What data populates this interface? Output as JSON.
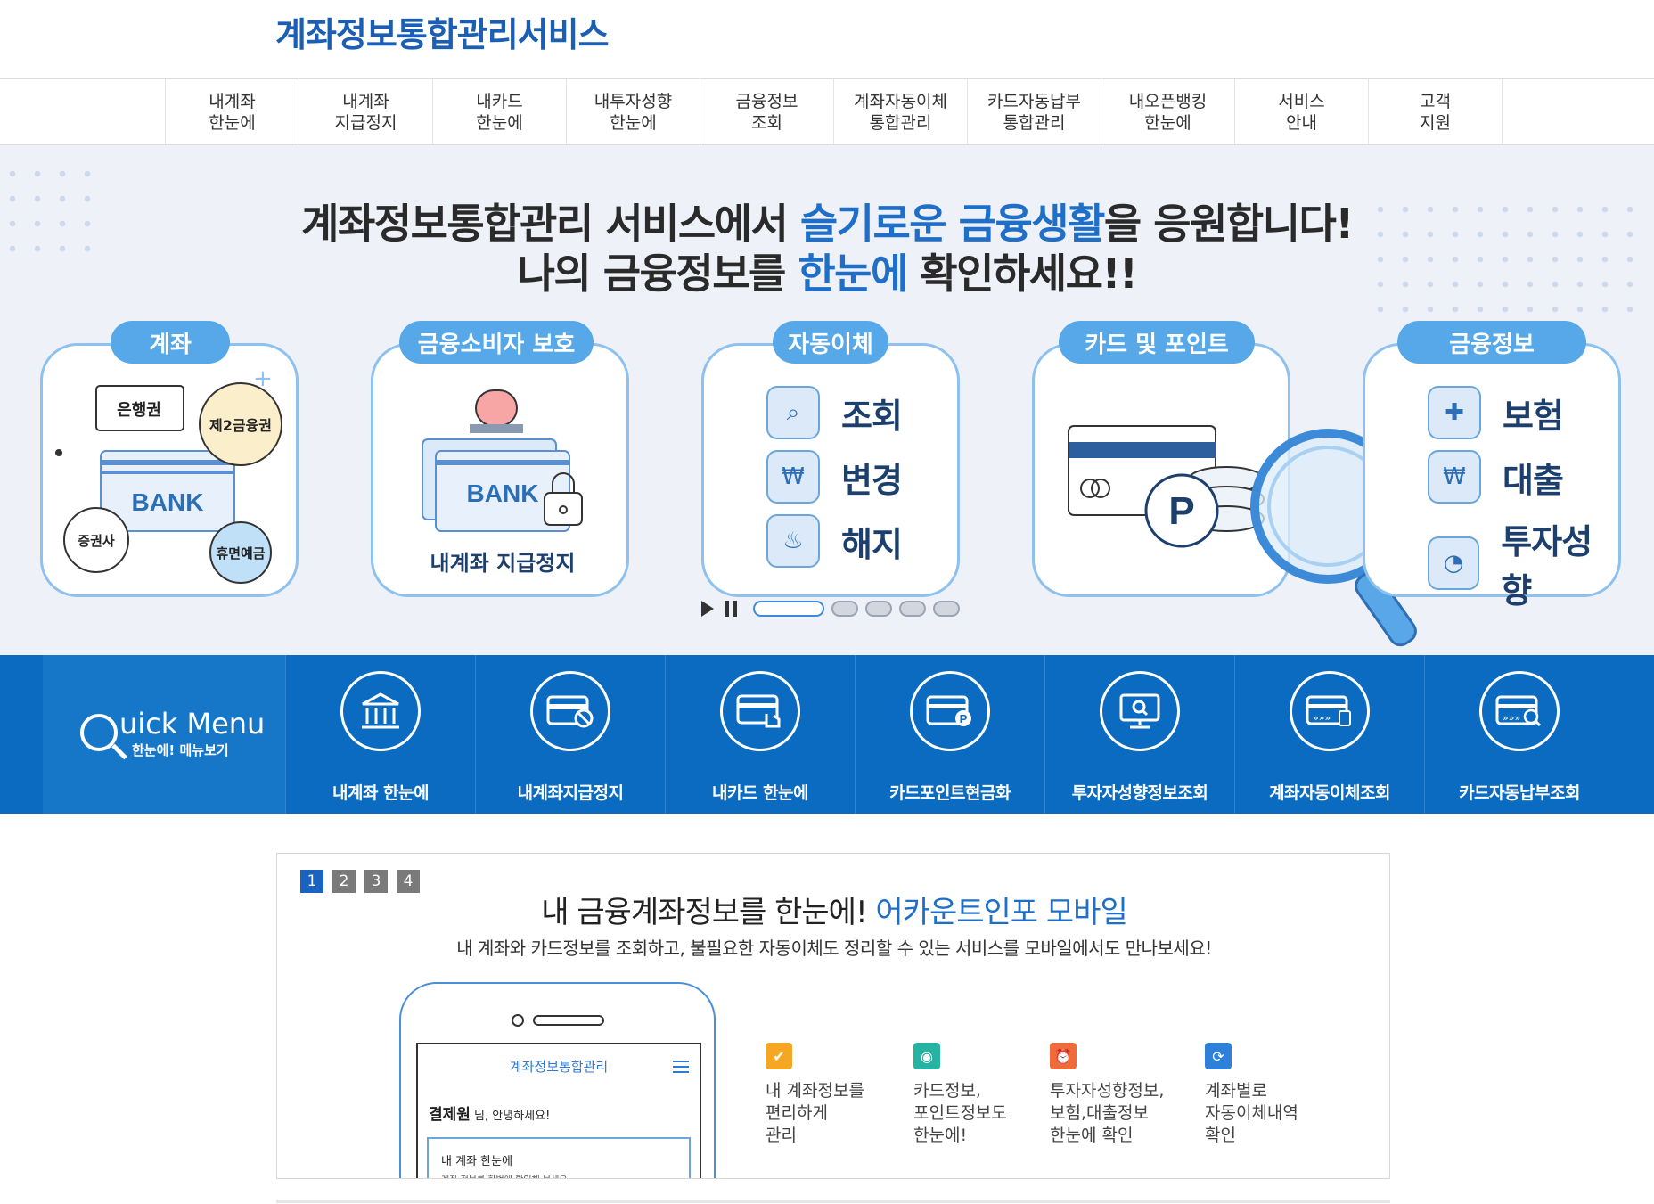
{
  "site": {
    "logo": "계좌정보통합관리서비스"
  },
  "gnb": [
    {
      "l1": "내계좌",
      "l2": "한눈에"
    },
    {
      "l1": "내계좌",
      "l2": "지급정지"
    },
    {
      "l1": "내카드",
      "l2": "한눈에"
    },
    {
      "l1": "내투자성향",
      "l2": "한눈에"
    },
    {
      "l1": "금융정보",
      "l2": "조회"
    },
    {
      "l1": "계좌자동이체",
      "l2": "통합관리"
    },
    {
      "l1": "카드자동납부",
      "l2": "통합관리"
    },
    {
      "l1": "내오픈뱅킹",
      "l2": "한눈에"
    },
    {
      "l1": "서비스",
      "l2": "안내"
    },
    {
      "l1": "고객",
      "l2": "지원"
    }
  ],
  "hero": {
    "line1_a": "계좌정보통합관리 서비스에서 ",
    "line1_hl": "슬기로운 금융생활",
    "line1_b": "을 응원합니다!",
    "line2_a": "나의 금융정보를 ",
    "line2_hl": "한눈에",
    "line2_b": " 확인하세요!!",
    "cards": [
      {
        "tag": "계좌",
        "bubbles": [
          "은행권",
          "제2금융권",
          "증권사",
          "휴면예금"
        ],
        "bank": "BANK"
      },
      {
        "tag": "금융소비자 보호",
        "bank": "BANK",
        "caption": "내계좌 지급정지"
      },
      {
        "tag": "자동이체",
        "items": [
          "조회",
          "변경",
          "해지"
        ]
      },
      {
        "tag": "카드 및 포인트",
        "point": "P"
      },
      {
        "tag": "금융정보",
        "items": [
          "보험",
          "대출",
          "투자성향"
        ]
      }
    ]
  },
  "quick": {
    "title": "uick Menu",
    "subtitle": "한눈에! 메뉴보기",
    "items": [
      "내계좌 한눈에",
      "내계좌지급정지",
      "내카드 한눈에",
      "카드포인트현금화",
      "투자자성향정보조회",
      "계좌자동이체조회",
      "카드자동납부조회"
    ]
  },
  "promo": {
    "tabs": [
      "1",
      "2",
      "3",
      "4"
    ],
    "title_a": "내 금융계좌정보를 한눈에! ",
    "title_hl": "어카운트인포 모바일",
    "subtitle": "내 계좌와 카드정보를 조회하고, 불필요한 자동이체도 정리할 수 있는 서비스를 모바일에서도 만나보세요!",
    "phone": {
      "app_title": "계좌정보통합관리",
      "user": "결제원",
      "greeting": " 님, 안녕하세요!",
      "box_title": "내 계좌 한눈에",
      "box_sub": "계좌 정보를 한번에 확인해 보세요!"
    },
    "features": [
      {
        "text": "내 계좌정보를\n편리하게\n관리",
        "color": "#f5a623"
      },
      {
        "text": "카드정보,\n포인트정보도\n한눈에!",
        "color": "#27b3a2"
      },
      {
        "text": "투자자성향정보,\n보험,대출정보\n한눈에 확인",
        "color": "#ef6b3a"
      },
      {
        "text": "계좌별로\n자동이체내역\n확인",
        "color": "#2f80d8"
      }
    ]
  }
}
